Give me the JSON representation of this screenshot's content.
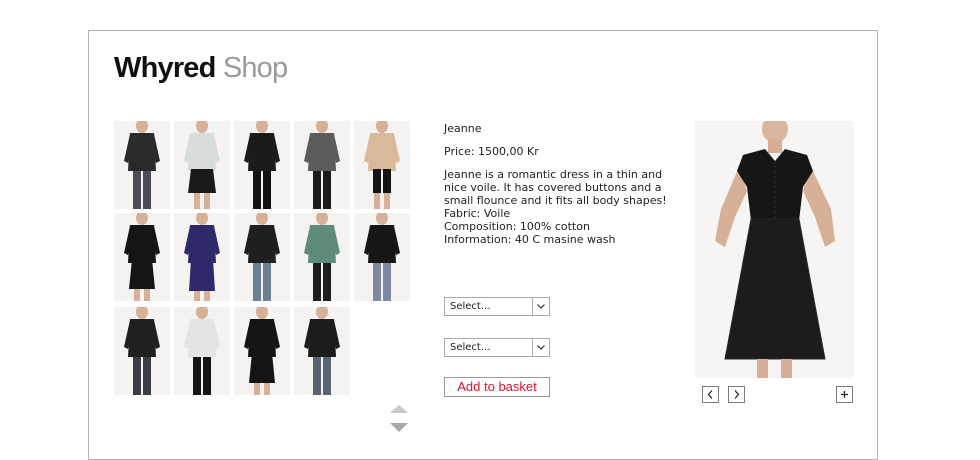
{
  "logo": {
    "brand": "Whyred",
    "section": "Shop"
  },
  "thumbnails": [
    {
      "name": "black-jacket",
      "top": "#2a2a2a",
      "bottom": "#4a4d55",
      "style": "pants"
    },
    {
      "name": "white-top-black-skirt",
      "top": "#d9dcdd",
      "bottom": "#1a1a1a",
      "style": "skirt"
    },
    {
      "name": "black-outfit",
      "top": "#1b1b1b",
      "bottom": "#121212",
      "style": "pants"
    },
    {
      "name": "grey-top-black-pants",
      "top": "#5b5b5b",
      "bottom": "#1a1a1a",
      "style": "pants"
    },
    {
      "name": "beige-top-black-capris",
      "top": "#d8b99a",
      "bottom": "#141414",
      "style": "capri"
    },
    {
      "name": "black-dress",
      "top": "#151515",
      "bottom": "#151515",
      "style": "dress"
    },
    {
      "name": "navy-coat",
      "top": "#2e2a6a",
      "bottom": "#2e2a6a",
      "style": "coat"
    },
    {
      "name": "black-shirt-jeans",
      "top": "#1f1f1f",
      "bottom": "#6d7f93",
      "style": "pants"
    },
    {
      "name": "printed-shirt",
      "top": "#5f8c77",
      "bottom": "#1d1d1d",
      "style": "pants"
    },
    {
      "name": "black-blouse-jeans",
      "top": "#161616",
      "bottom": "#7f8aa0",
      "style": "pants"
    },
    {
      "name": "black-leather-jacket",
      "top": "#202020",
      "bottom": "#3a3d44",
      "style": "pants"
    },
    {
      "name": "white-shirt",
      "top": "#e4e4e4",
      "bottom": "#161616",
      "style": "pants"
    },
    {
      "name": "black-knit-dress",
      "top": "#141414",
      "bottom": "#141414",
      "style": "dress"
    },
    {
      "name": "black-cardigan",
      "top": "#1c1c1c",
      "bottom": "#5a6372",
      "style": "pants"
    }
  ],
  "product": {
    "name": "Jeanne",
    "price": "Price: 1500,00 Kr",
    "description_lines": [
      "Jeanne is a romantic dress in a thin and",
      "nice voile. It has covered buttons and a",
      "small flounce and it fits all body shapes!",
      "Fabric: Voile",
      "Composition: 100% cotton",
      "Information: 40 C masine wash"
    ]
  },
  "selects": {
    "size": {
      "value": "Select..."
    },
    "color": {
      "value": "Select..."
    }
  },
  "buttons": {
    "add_to_basket": "Add to basket"
  },
  "colors": {
    "accent": "#e0142b",
    "logo_grey": "#9a9a9a",
    "border": "#b4b4b4"
  },
  "icons": {
    "prev": "chevron-left-icon",
    "next": "chevron-right-icon",
    "zoom": "plus-icon",
    "scroll_up": "triangle-up-icon",
    "scroll_down": "triangle-down-icon",
    "dropdown": "chevron-down-icon"
  }
}
